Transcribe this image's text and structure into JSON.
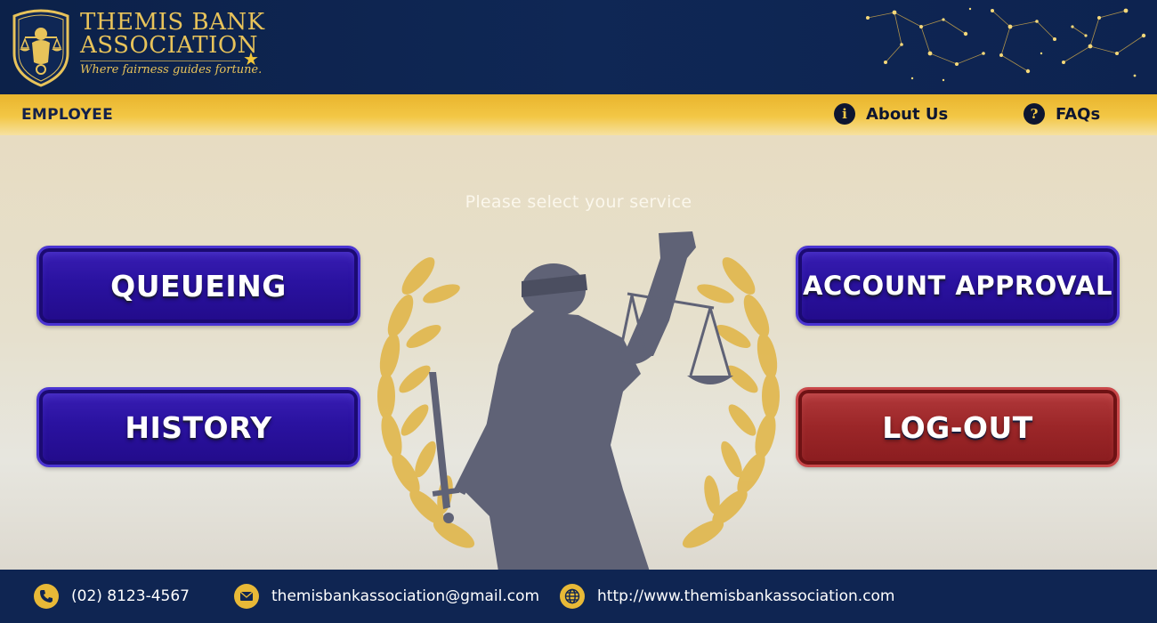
{
  "header": {
    "brand_line1": "THEMIS BANK",
    "brand_line2": "ASSOCIATION",
    "tagline": "Where fairness guides fortune.",
    "logo_icon": "scales-crest-icon",
    "decoration": "constellation-stars"
  },
  "navbar": {
    "role_label": "EMPLOYEE",
    "about_label": "About Us",
    "about_icon": "info-icon",
    "faq_label": "FAQs",
    "faq_icon": "question-icon"
  },
  "main": {
    "prompt": "Please select your service",
    "buttons": {
      "queueing": "QUEUEING",
      "history": "HISTORY",
      "account_approval": "ACCOUNT APPROVAL",
      "logout": "LOG-OUT"
    },
    "background_art": "lady-justice-laurel-wreath"
  },
  "footer": {
    "phone": "(02) 8123-4567",
    "email": "themisbankassociation@gmail.com",
    "website": "http://www.themisbankassociation.com"
  },
  "colors": {
    "navy": "#0f2552",
    "gold": "#e8c35a",
    "yellow_bar": "#f3c746",
    "button_blue": "#2a12a0",
    "button_red": "#9b2628"
  }
}
